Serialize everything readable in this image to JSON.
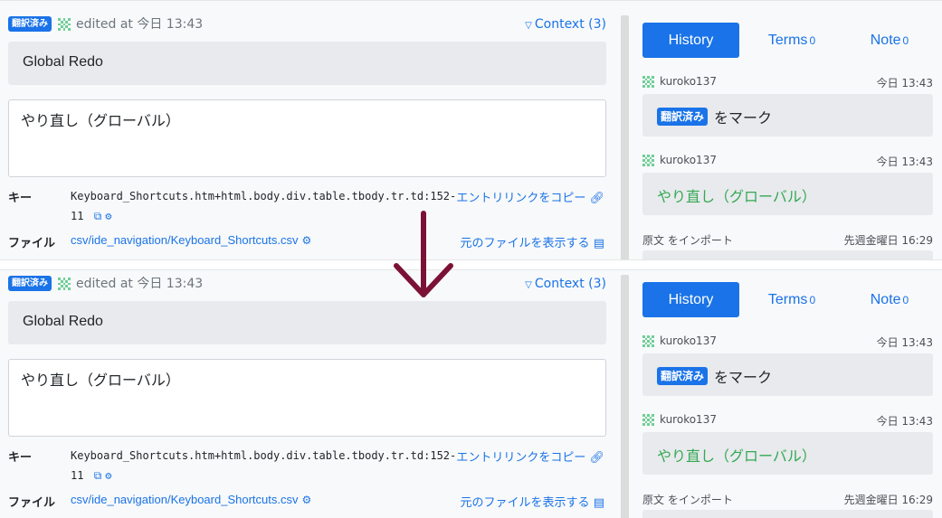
{
  "colors": {
    "accent": "#1a73e8",
    "arrow": "#7b1236",
    "translated_green": "#34a853"
  },
  "editor": {
    "badge": "翻訳済み",
    "edited": "edited at 今日 13:43",
    "context_link": "Context (3)",
    "source_text": "Global Redo",
    "translation_text": "やり直し（グローバル）",
    "key_label": "キー",
    "key_value": "Keyboard_Shortcuts.htm+html.body.div.table.tbody.tr.td:152-11",
    "file_label": "ファイル",
    "file_value": "csv/ide_navigation/Keyboard_Shortcuts.csv",
    "copy_link": "エントリリンクをコピー",
    "view_file_link": "元のファイルを表示する"
  },
  "sidebar": {
    "tabs": [
      {
        "label": "History",
        "count": ""
      },
      {
        "label": "Terms",
        "count": "0"
      },
      {
        "label": "Note",
        "count": "0"
      }
    ],
    "history": [
      {
        "user": "kuroko137",
        "time": "今日 13:43",
        "badge": "翻訳済み",
        "text": "をマーク"
      },
      {
        "user": "kuroko137",
        "time": "今日 13:43",
        "text": "やり直し（グローバル）"
      },
      {
        "user": "原文 をインポート",
        "time": "先週金曜日 16:29"
      }
    ]
  }
}
